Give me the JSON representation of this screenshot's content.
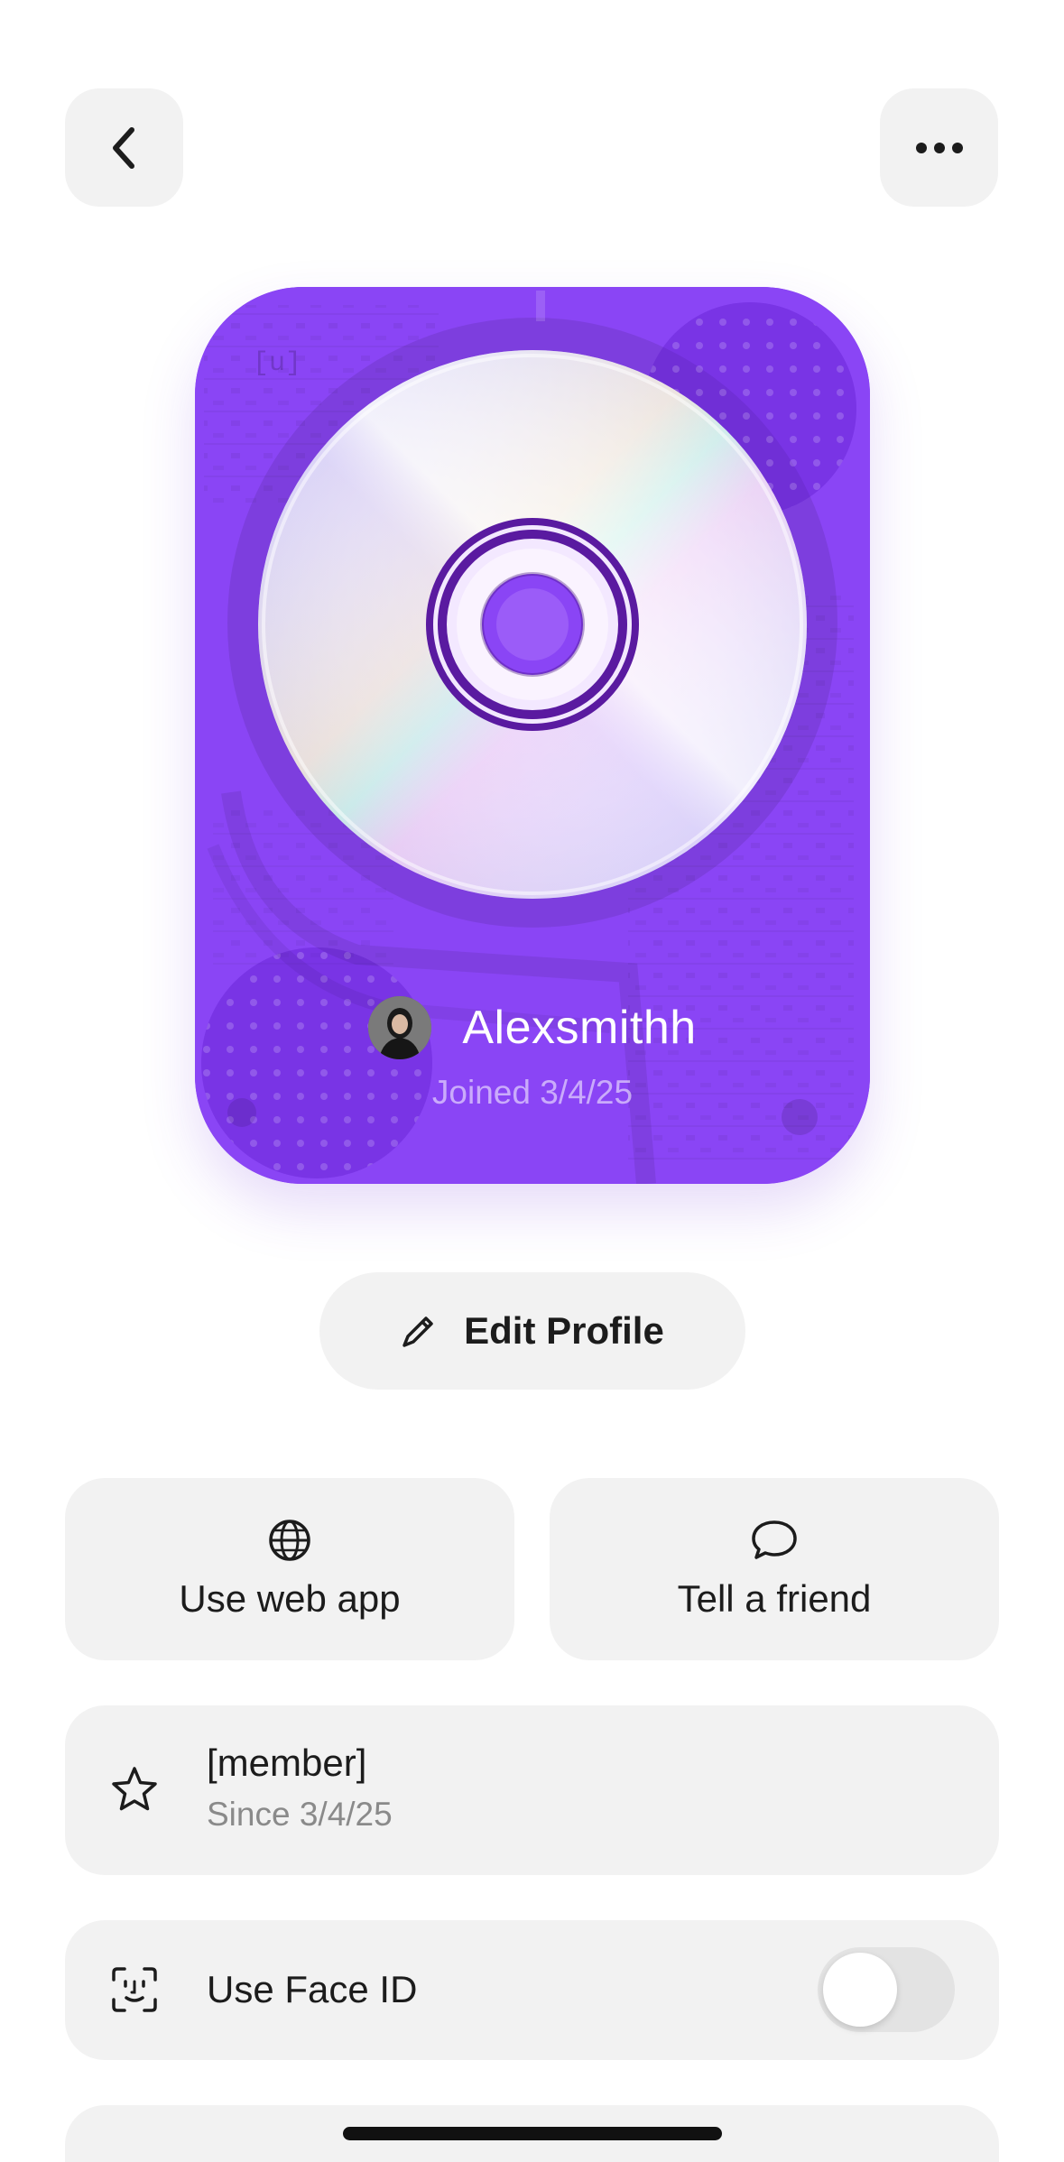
{
  "header": {
    "back_icon": "chevron-left-icon",
    "more_icon": "more-horizontal-icon"
  },
  "profile_card": {
    "watermark": "[u]",
    "username": "Alexsmithh",
    "joined": "Joined 3/4/25",
    "card_color": "#8a45f5",
    "disc_accent": "#5a1aa0"
  },
  "edit_profile": {
    "label": "Edit Profile",
    "icon": "pencil-icon"
  },
  "actions": [
    {
      "label": "Use web app",
      "icon": "globe-icon"
    },
    {
      "label": "Tell a friend",
      "icon": "chat-bubble-icon"
    }
  ],
  "membership": {
    "title": "[member]",
    "subtitle": "Since 3/4/25",
    "icon": "star-icon"
  },
  "face_id": {
    "label": "Use Face ID",
    "icon": "face-id-icon",
    "enabled": false
  }
}
